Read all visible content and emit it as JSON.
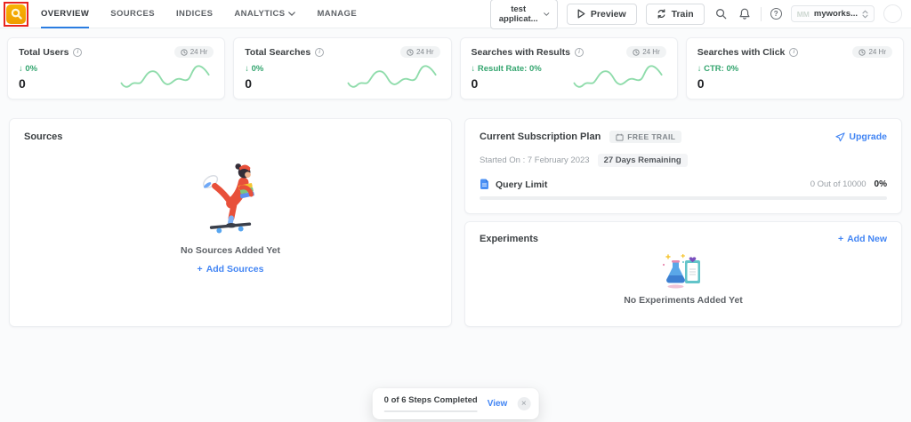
{
  "header": {
    "nav": [
      {
        "label": "OVERVIEW",
        "active": true
      },
      {
        "label": "SOURCES",
        "active": false
      },
      {
        "label": "INDICES",
        "active": false
      },
      {
        "label": "ANALYTICS",
        "active": false,
        "has_dropdown": true
      },
      {
        "label": "MANAGE",
        "active": false
      }
    ],
    "app_selector_value": "test applicat...",
    "preview_label": "Preview",
    "train_label": "Train",
    "workspace_prefix": "MM",
    "workspace_name": "myworks..."
  },
  "stats": {
    "time_range_label": "24 Hr",
    "cards": [
      {
        "title": "Total Users",
        "delta": "↓ 0%",
        "value": "0",
        "sparkline": true
      },
      {
        "title": "Total Searches",
        "delta": "↓ 0%",
        "value": "0",
        "sparkline": true
      },
      {
        "title": "Searches with Results",
        "delta": "↓ Result Rate: 0%",
        "value": "0",
        "sparkline": true
      },
      {
        "title": "Searches with Click",
        "delta": "↓ CTR: 0%",
        "value": "0",
        "sparkline": false
      }
    ]
  },
  "sources_panel": {
    "title": "Sources",
    "empty_message": "No Sources Added Yet",
    "add_button_label": "Add Sources"
  },
  "subscription_panel": {
    "title": "Current Subscription Plan",
    "plan_badge": "FREE TRAIL",
    "upgrade_label": "Upgrade",
    "started_on": "Started On : 7 February 2023",
    "days_remaining": "27 Days Remaining",
    "query_limit_label": "Query Limit",
    "usage_text": "0 Out of 10000",
    "usage_percent": "0%",
    "progress_percent": 0
  },
  "experiments_panel": {
    "title": "Experiments",
    "add_button_label": "Add New",
    "empty_message": "No Experiments Added Yet"
  },
  "toast": {
    "message": "0 of 6 Steps Completed",
    "action_label": "View",
    "close_glyph": "×",
    "progress_percent": 0
  },
  "icons": {
    "plus": "+",
    "info": "i",
    "help": "?"
  },
  "colors": {
    "accent_blue": "#4285f4",
    "positive_green": "#34a56f",
    "sparkline_green": "#8fdcab",
    "logo_amber": "#f5a61d",
    "annotation_red": "#e8251f"
  }
}
